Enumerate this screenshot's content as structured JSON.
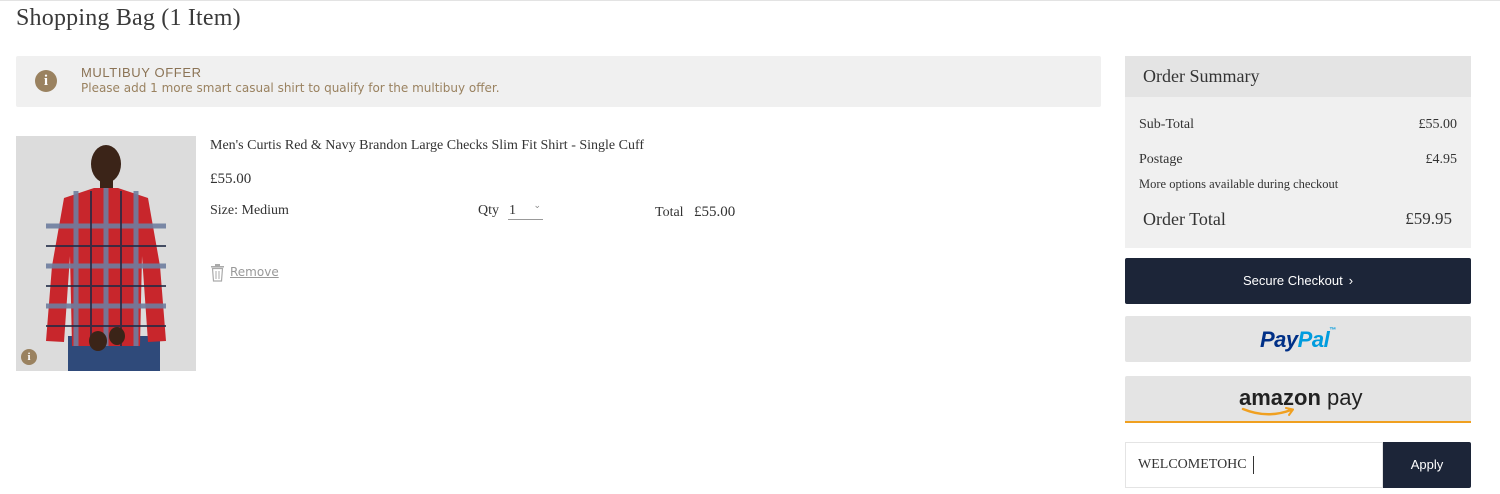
{
  "page": {
    "title": "Shopping Bag (1 Item)"
  },
  "offer": {
    "icon": "info-icon",
    "title": "MULTIBUY OFFER",
    "message": "Please add 1 more smart casual shirt to qualify for the multibuy offer."
  },
  "item": {
    "image_icon": "info-icon",
    "name": "Men's Curtis Red & Navy Brandon Large Checks Slim Fit Shirt - Single Cuff",
    "price": "£55.00",
    "size_label": "Size:",
    "size_value": "Medium",
    "qty_label": "Qty",
    "qty_value": "1",
    "total_label": "Total",
    "total_value": "£55.00",
    "remove_label": "Remove"
  },
  "summary": {
    "heading": "Order Summary",
    "subtotal_label": "Sub-Total",
    "subtotal_value": "£55.00",
    "postage_label": "Postage",
    "postage_value": "£4.95",
    "postage_note": "More options available during checkout",
    "order_total_label": "Order Total",
    "order_total_value": "£59.95"
  },
  "actions": {
    "checkout_label": "Secure Checkout",
    "checkout_arrow": "›",
    "paypal_pay": "Pay",
    "paypal_pal": "Pal",
    "paypal_tm": "™",
    "amazon_word": "amazon",
    "amazon_pay": " pay"
  },
  "promo": {
    "value": "WELCOMETOHC",
    "apply_label": "Apply"
  },
  "colors": {
    "accent_gold": "#9a8260",
    "navy_button": "#1c2538",
    "amazon_orange": "#f0a020",
    "paypal_dark": "#003087",
    "paypal_light": "#009cde"
  }
}
